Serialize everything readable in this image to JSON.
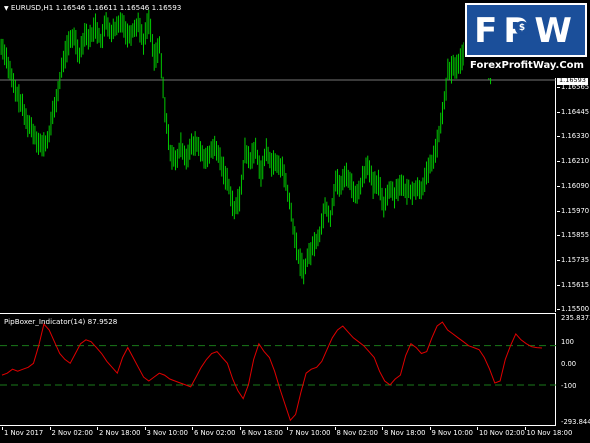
{
  "symbol_info": "EURUSD,H1  1.16546 1.16611 1.16546 1.16593",
  "indicator_info": "PipBoxer_Indicator(14) 87.9528",
  "current_price": "1.16593",
  "price_axis": [
    "1.16565",
    "1.16445",
    "1.16330",
    "1.16210",
    "1.16090",
    "1.15970",
    "1.15855",
    "1.15735",
    "1.15615",
    "1.15500"
  ],
  "indicator_axis": [
    "235.8373",
    "100",
    "0.00",
    "-100",
    "-293.8443"
  ],
  "time_axis": [
    "1 Nov 2017",
    "2 Nov 02:00",
    "2 Nov 18:00",
    "3 Nov 10:00",
    "6 Nov 02:00",
    "6 Nov 18:00",
    "7 Nov 10:00",
    "8 Nov 02:00",
    "8 Nov 18:00",
    "9 Nov 10:00",
    "10 Nov 02:00",
    "10 Nov 18:00"
  ],
  "logo": {
    "letters": "FPW",
    "site": "ForexProfitWay.Com"
  },
  "colors": {
    "background": "#000000",
    "candles": "#00e000",
    "indicator_line": "#e00000",
    "level_lines": "#1a7a1a",
    "logo_bg": "#1b4f9a"
  },
  "chart_data": {
    "type": "line",
    "title": "EURUSD,H1",
    "series": [
      {
        "name": "EURUSD,H1",
        "values": [
          1.1651,
          1.1648,
          1.164,
          1.1633,
          1.1629,
          1.1622,
          1.1619,
          1.1615,
          1.1612,
          1.1614,
          1.1624,
          1.1633,
          1.1645,
          1.1651,
          1.1654,
          1.1647,
          1.1655,
          1.1653,
          1.1658,
          1.1652,
          1.1659,
          1.1655,
          1.1657,
          1.166,
          1.1654,
          1.1656,
          1.1659,
          1.1652,
          1.166,
          1.1646,
          1.165,
          1.1626,
          1.161,
          1.1606,
          1.1612,
          1.1608,
          1.1612,
          1.1613,
          1.1609,
          1.1607,
          1.1612,
          1.1609,
          1.1603,
          1.1597,
          1.1588,
          1.1592,
          1.161,
          1.1607,
          1.1611,
          1.1602,
          1.161,
          1.1606,
          1.1605,
          1.1604,
          1.1595,
          1.1582,
          1.157,
          1.1565,
          1.1571,
          1.1575,
          1.1579,
          1.159,
          1.1585,
          1.1599,
          1.1597,
          1.1602,
          1.1597,
          1.1593,
          1.16,
          1.1606,
          1.1597,
          1.1598,
          1.159,
          1.1596,
          1.1594,
          1.1598,
          1.1595,
          1.1595,
          1.1596,
          1.1596,
          1.1601,
          1.1606,
          1.1613,
          1.1624,
          1.164,
          1.1642,
          1.1643,
          1.1647,
          1.1652,
          1.1646,
          1.1649,
          1.1643,
          1.1641,
          1.1645,
          1.1646,
          1.165,
          1.1648,
          1.1656,
          1.1659,
          1.1657,
          1.1659,
          1.1657,
          1.1658,
          1.1659
        ]
      },
      {
        "name": "PipBoxer_Indicator(14)",
        "values": [
          -50,
          -40,
          -20,
          -30,
          -20,
          -10,
          10,
          100,
          210,
          180,
          120,
          60,
          30,
          10,
          60,
          110,
          130,
          120,
          90,
          60,
          20,
          -10,
          -40,
          40,
          90,
          40,
          -10,
          -60,
          -80,
          -60,
          -40,
          -50,
          -70,
          -80,
          -90,
          -100,
          -110,
          -60,
          -10,
          30,
          60,
          70,
          40,
          10,
          -70,
          -130,
          -170,
          -100,
          30,
          110,
          70,
          40,
          -30,
          -120,
          -200,
          -280,
          -250,
          -140,
          -40,
          -20,
          -10,
          20,
          80,
          140,
          180,
          200,
          170,
          140,
          120,
          100,
          70,
          40,
          -30,
          -80,
          -100,
          -70,
          -50,
          50,
          110,
          90,
          60,
          70,
          140,
          200,
          220,
          180,
          160,
          140,
          120,
          100,
          90,
          80,
          40,
          -20,
          -90,
          -80,
          30,
          100,
          160,
          130,
          110,
          95,
          90,
          88
        ]
      }
    ],
    "ylim_price": [
      1.155,
      1.166
    ],
    "ylim_indicator": [
      -293.8443,
      235.8373
    ],
    "indicator_levels": [
      100,
      -100
    ],
    "grid": false
  }
}
